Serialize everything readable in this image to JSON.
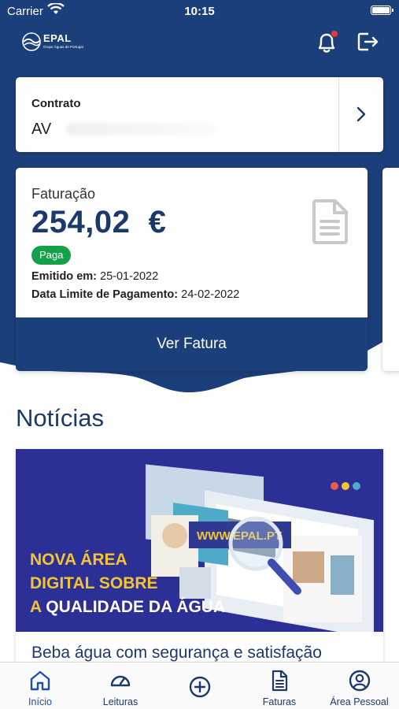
{
  "status_bar": {
    "carrier": "Carrier",
    "time": "10:15",
    "icons": [
      "wifi-icon",
      "battery-icon"
    ]
  },
  "header": {
    "logo_name": "EPAL",
    "logo_tagline": "Grupo Águas de Portugal",
    "icons": [
      "bell-icon",
      "logout-icon"
    ],
    "notification_dot": true
  },
  "contract": {
    "label": "Contrato",
    "value": "AV"
  },
  "billing": {
    "label": "Faturação",
    "amount": "254,02  €",
    "status": "Paga",
    "issued_label": "Emitido em:",
    "issued_value": "25-01-2022",
    "due_label": "Data Limite de Pagamento:",
    "due_value": "24-02-2022",
    "view_button": "Ver Fatura"
  },
  "news": {
    "section_title": "Notícias",
    "banner_line1": "NOVA ÁREA",
    "banner_line2": "DIGITAL SOBRE",
    "banner_line3_a": "A",
    "banner_line3_b": "QUALIDADE DA ÁGUA",
    "banner_site": "WWW.EPAL.PT",
    "headline": "Beba água com segurança e satisfação"
  },
  "tabs": [
    {
      "label": "Início",
      "icon": "home-icon",
      "active": true
    },
    {
      "label": "Leituras",
      "icon": "gauge-icon",
      "active": false
    },
    {
      "label": "",
      "icon": "plus-circle-icon",
      "active": false
    },
    {
      "label": "Faturas",
      "icon": "invoice-icon",
      "active": false
    },
    {
      "label": "Área Pessoal",
      "icon": "user-icon",
      "active": false
    }
  ],
  "colors": {
    "primary": "#1b3f7a",
    "paid_badge": "#16a04a",
    "notification": "#e53935",
    "banner_accent": "#f4c430",
    "banner_bg": "#2b2f96"
  }
}
